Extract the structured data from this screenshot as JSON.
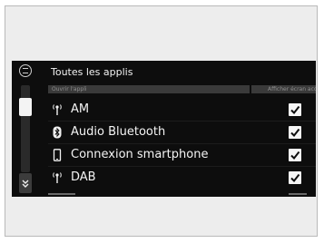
{
  "header": {
    "title": "Toutes les applis",
    "col_left": "Ouvrir l'appli",
    "col_right": "Afficher écran acc."
  },
  "items": [
    {
      "label": "AM",
      "icon": "antenna-icon",
      "glyph": "὎1",
      "checked": true
    },
    {
      "label": "Audio Bluetooth",
      "icon": "bluetooth-icon",
      "checked": true
    },
    {
      "label": "Connexion smartphone",
      "icon": "smartphone-icon",
      "checked": true
    },
    {
      "label": "DAB",
      "icon": "antenna-icon",
      "checked": true
    }
  ],
  "colors": {
    "background": "#0d0d0d",
    "text": "#f4f4f4",
    "header_bar": "#3a3a3a",
    "checkbox": "#f6f6f6"
  }
}
